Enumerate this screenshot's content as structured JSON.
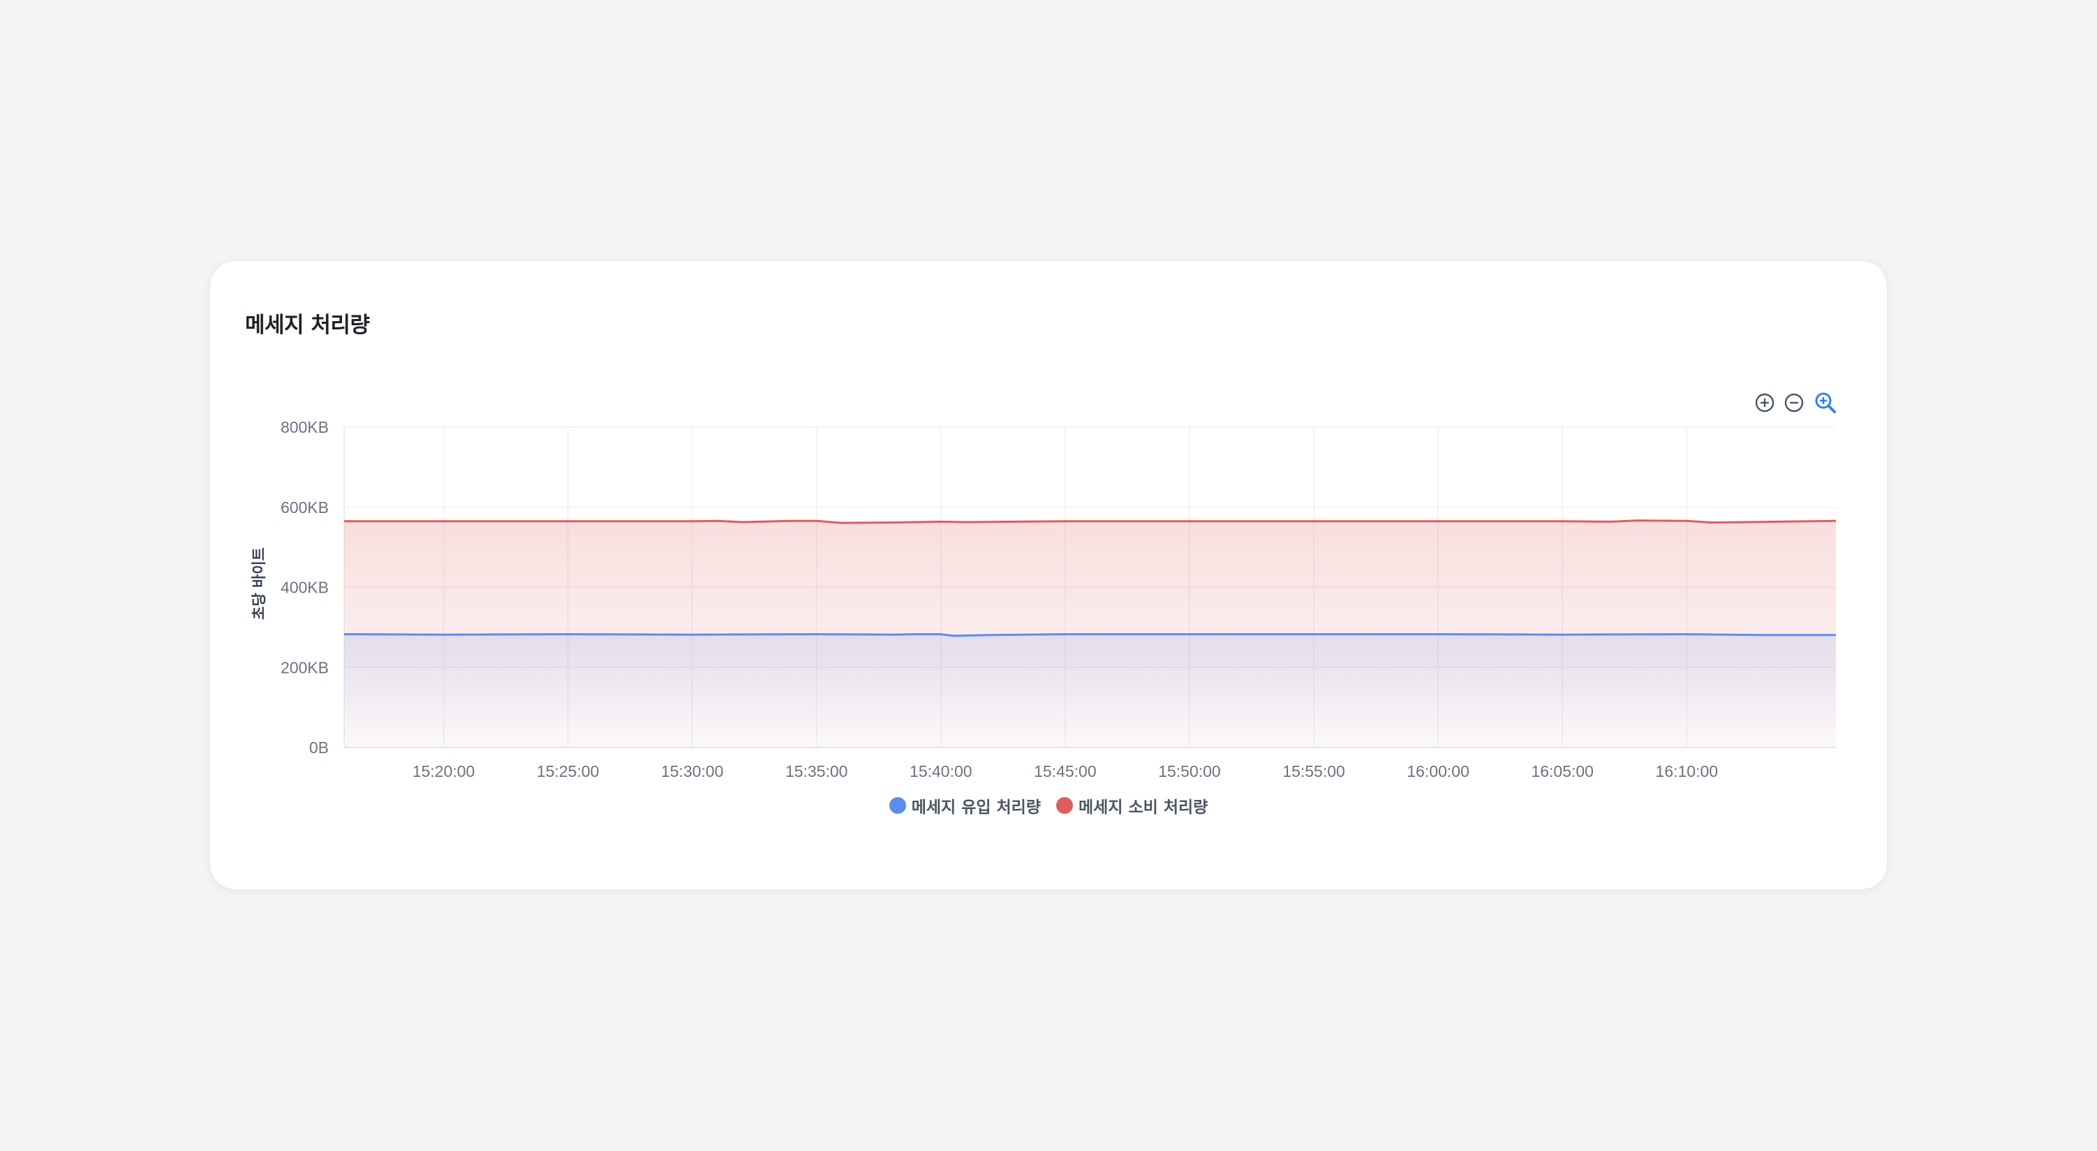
{
  "card": {
    "title": "메세지 처리량"
  },
  "toolbar": {
    "zoom_in_icon": "plus-circle-icon",
    "zoom_out_icon": "minus-circle-icon",
    "zoom_reset_icon": "magnifier-plus-icon",
    "zoom_reset_color": "#2f80ed"
  },
  "chart_data": {
    "type": "area",
    "title": "",
    "xlabel": "",
    "ylabel": "초당 바이트",
    "x_ticks": [
      "15:20:00",
      "15:25:00",
      "15:30:00",
      "15:35:00",
      "15:40:00",
      "15:45:00",
      "15:50:00",
      "15:55:00",
      "16:00:00",
      "16:05:00",
      "16:10:00"
    ],
    "y_ticks": [
      "0B",
      "200KB",
      "400KB",
      "600KB",
      "800KB"
    ],
    "ylim": [
      0,
      800
    ],
    "y_unit": "KB",
    "xlim": [
      "15:16:00",
      "16:16:00"
    ],
    "grid": true,
    "legend_placement": "bottom-center",
    "series": [
      {
        "name": "메세지 유입 처리량",
        "color": "#5b8def",
        "x": [
          "15:16:00",
          "15:20:00",
          "15:25:00",
          "15:30:00",
          "15:35:00",
          "15:38:00",
          "15:39:00",
          "15:40:00",
          "15:40:30",
          "15:42:00",
          "15:45:00",
          "15:50:00",
          "15:55:00",
          "16:00:00",
          "16:05:00",
          "16:10:00",
          "16:13:00",
          "16:16:00"
        ],
        "values": [
          283,
          282,
          283,
          282,
          283,
          282,
          283,
          283,
          279,
          281,
          283,
          283,
          283,
          283,
          282,
          283,
          281,
          281
        ]
      },
      {
        "name": "메세지 소비 처리량",
        "color": "#e05d5d",
        "x": [
          "15:16:00",
          "15:20:00",
          "15:25:00",
          "15:30:00",
          "15:31:00",
          "15:32:00",
          "15:34:00",
          "15:35:00",
          "15:36:00",
          "15:38:00",
          "15:40:00",
          "15:41:00",
          "15:45:00",
          "15:50:00",
          "15:55:00",
          "16:00:00",
          "16:05:00",
          "16:07:00",
          "16:08:00",
          "16:10:00",
          "16:11:00",
          "16:16:00"
        ],
        "values": [
          565,
          565,
          565,
          565,
          566,
          563,
          566,
          566,
          561,
          562,
          564,
          563,
          565,
          565,
          565,
          565,
          565,
          564,
          567,
          566,
          562,
          566
        ]
      }
    ]
  }
}
